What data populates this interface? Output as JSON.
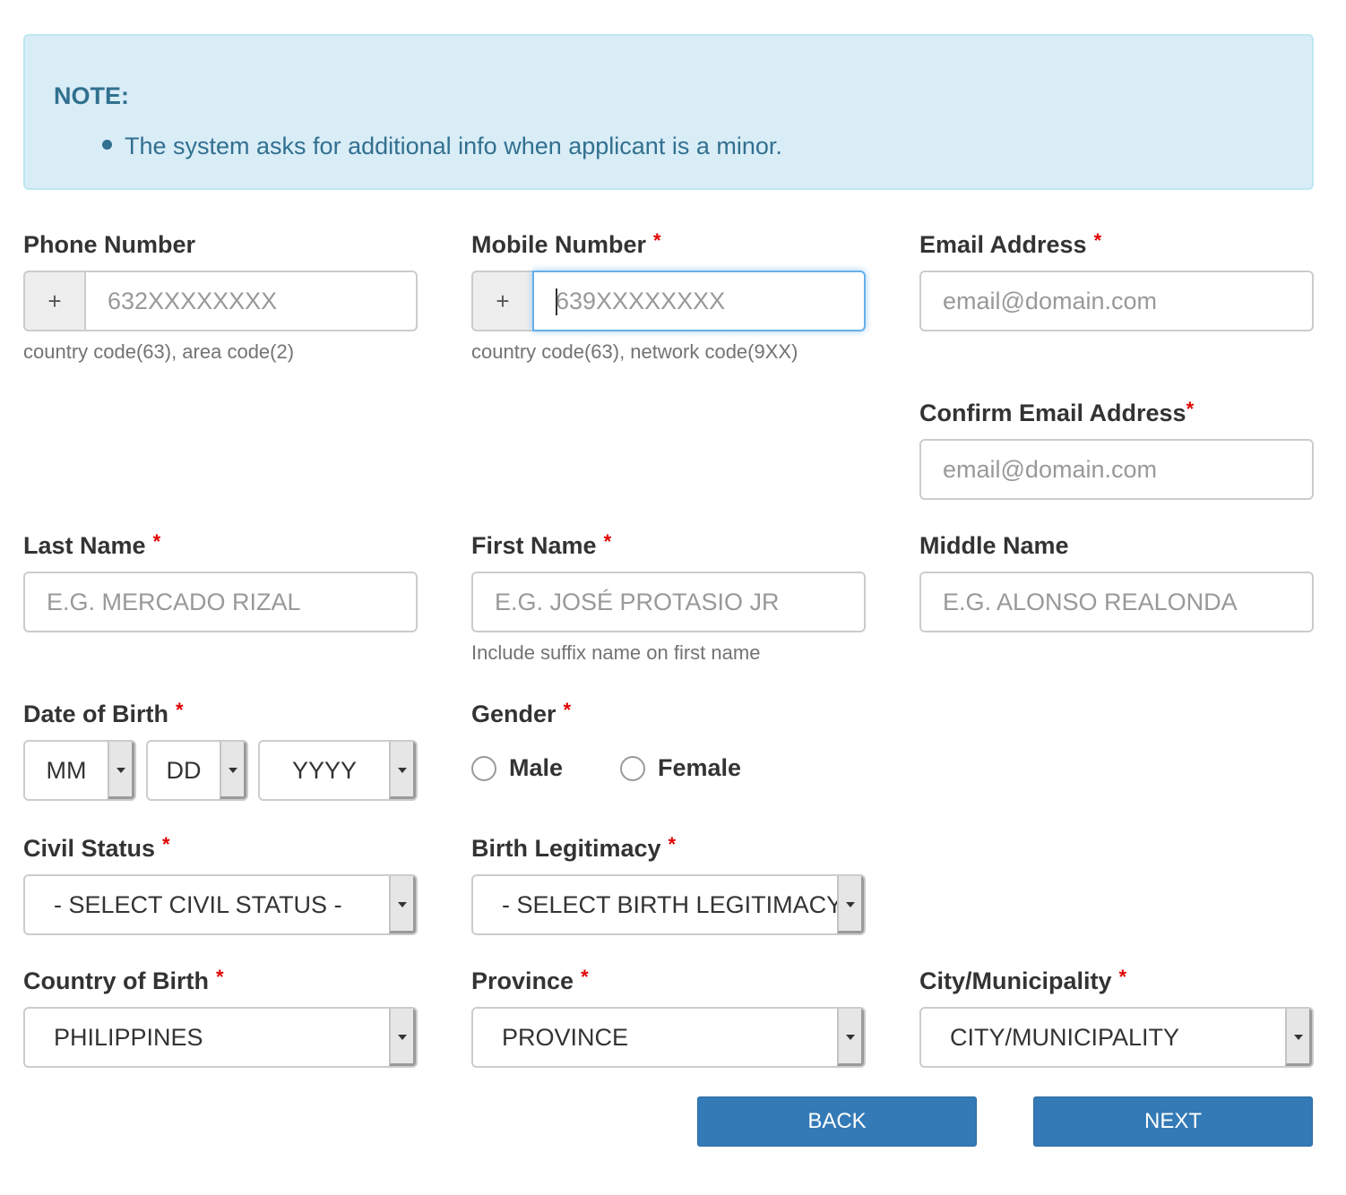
{
  "note": {
    "title": "NOTE:",
    "bullet": "The system asks for additional info when applicant is a minor."
  },
  "phone": {
    "label": "Phone Number",
    "prefix": "+",
    "placeholder": "632XXXXXXXX",
    "help": "country code(63), area code(2)"
  },
  "mobile": {
    "label": "Mobile Number",
    "required": "*",
    "prefix": "+",
    "placeholder": "639XXXXXXXX",
    "help": "country code(63), network code(9XX)"
  },
  "email": {
    "label": "Email Address",
    "required": "*",
    "placeholder": "email@domain.com"
  },
  "confirm_email": {
    "label": "Confirm Email Address",
    "required": "*",
    "placeholder": "email@domain.com"
  },
  "last_name": {
    "label": "Last Name",
    "required": "*",
    "placeholder": "E.G. MERCADO RIZAL"
  },
  "first_name": {
    "label": "First Name",
    "required": "*",
    "placeholder": "E.G. JOSÉ PROTASIO JR",
    "help": "Include suffix name on first name"
  },
  "middle_name": {
    "label": "Middle Name",
    "placeholder": "E.G. ALONSO REALONDA"
  },
  "dob": {
    "label": "Date of Birth",
    "required": "*",
    "month": "MM",
    "day": "DD",
    "year": "YYYY"
  },
  "gender": {
    "label": "Gender",
    "required": "*",
    "options": [
      "Male",
      "Female"
    ]
  },
  "civil_status": {
    "label": "Civil Status",
    "required": "*",
    "selected": "- SELECT CIVIL STATUS -"
  },
  "birth_legitimacy": {
    "label": "Birth Legitimacy",
    "required": "*",
    "selected": "- SELECT BIRTH LEGITIMACY -"
  },
  "country_of_birth": {
    "label": "Country of Birth",
    "required": "*",
    "selected": "PHILIPPINES"
  },
  "province": {
    "label": "Province",
    "required": "*",
    "selected": "PROVINCE"
  },
  "city": {
    "label": "City/Municipality",
    "required": "*",
    "selected": "CITY/MUNICIPALITY"
  },
  "buttons": {
    "back": "BACK",
    "next": "NEXT"
  },
  "colors": {
    "note_bg": "#d9edf7",
    "note_text": "#31708f",
    "primary": "#337ab7",
    "required": "#e00000"
  }
}
